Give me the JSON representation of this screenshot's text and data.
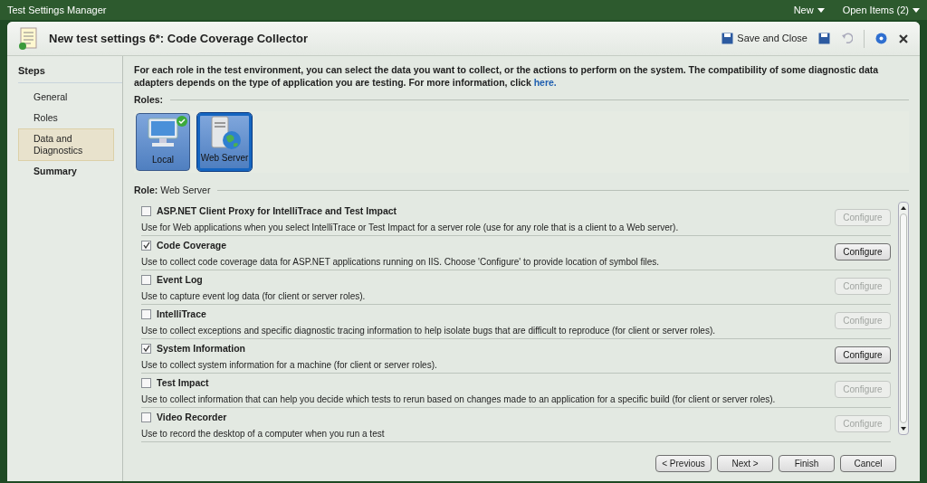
{
  "app_bar": {
    "title": "Test Settings Manager",
    "menus": [
      {
        "label": "New"
      },
      {
        "label": "Open Items (2)"
      }
    ]
  },
  "dialog": {
    "title": "New test settings 6*: Code Coverage Collector",
    "toolbar": {
      "save_and_close": "Save and Close"
    }
  },
  "steps": {
    "title": "Steps",
    "items": [
      {
        "label": "General",
        "selected": false,
        "bold": false
      },
      {
        "label": "Roles",
        "selected": false,
        "bold": false
      },
      {
        "label": "Data and Diagnostics",
        "selected": true,
        "bold": false
      },
      {
        "label": "Summary",
        "selected": false,
        "bold": true
      }
    ]
  },
  "description": {
    "text": "For each role in the test environment, you can select the data you want to collect, or the actions to perform on the system. The compatibility of some diagnostic data adapters depends on the type of application you are testing. For more information, click",
    "link": "here."
  },
  "roles": {
    "label": "Roles:",
    "items": [
      {
        "label": "Local",
        "kind": "computer",
        "selected": false,
        "configured": true
      },
      {
        "label": "Web Server",
        "kind": "server",
        "selected": true,
        "configured": false
      }
    ]
  },
  "role": {
    "label": "Role:",
    "value": "Web Server"
  },
  "adapters": [
    {
      "name": "ASP.NET Client Proxy for IntelliTrace and Test Impact",
      "description": "Use for Web applications when you select IntelliTrace or Test Impact for a server role (use for any role that is a client to a Web server).",
      "checked": false,
      "button": "Configure"
    },
    {
      "name": "Code Coverage",
      "description": "Use to collect code coverage data for ASP.NET applications running on IIS. Choose 'Configure' to provide location of symbol files.",
      "checked": true,
      "button": "Configure"
    },
    {
      "name": "Event Log",
      "description": "Use to capture event log data (for client or server roles).",
      "checked": false,
      "button": "Configure"
    },
    {
      "name": "IntelliTrace",
      "description": "Use to collect exceptions and specific diagnostic tracing information to help isolate bugs that are difficult to reproduce (for client or server roles).",
      "checked": false,
      "button": "Configure"
    },
    {
      "name": "System Information",
      "description": "Use to collect system information for a machine (for client or server roles).",
      "checked": true,
      "button": "Configure"
    },
    {
      "name": "Test Impact",
      "description": "Use to collect information that can help you decide which tests to rerun based on changes made to an application for a specific build (for client or server roles).",
      "checked": false,
      "button": "Configure"
    },
    {
      "name": "Video Recorder",
      "description": "Use to record the desktop of a computer when you run a test",
      "checked": false,
      "button": "Configure"
    }
  ],
  "footer_buttons": [
    "< Previous",
    "Next >",
    "Finish",
    "Cancel"
  ]
}
